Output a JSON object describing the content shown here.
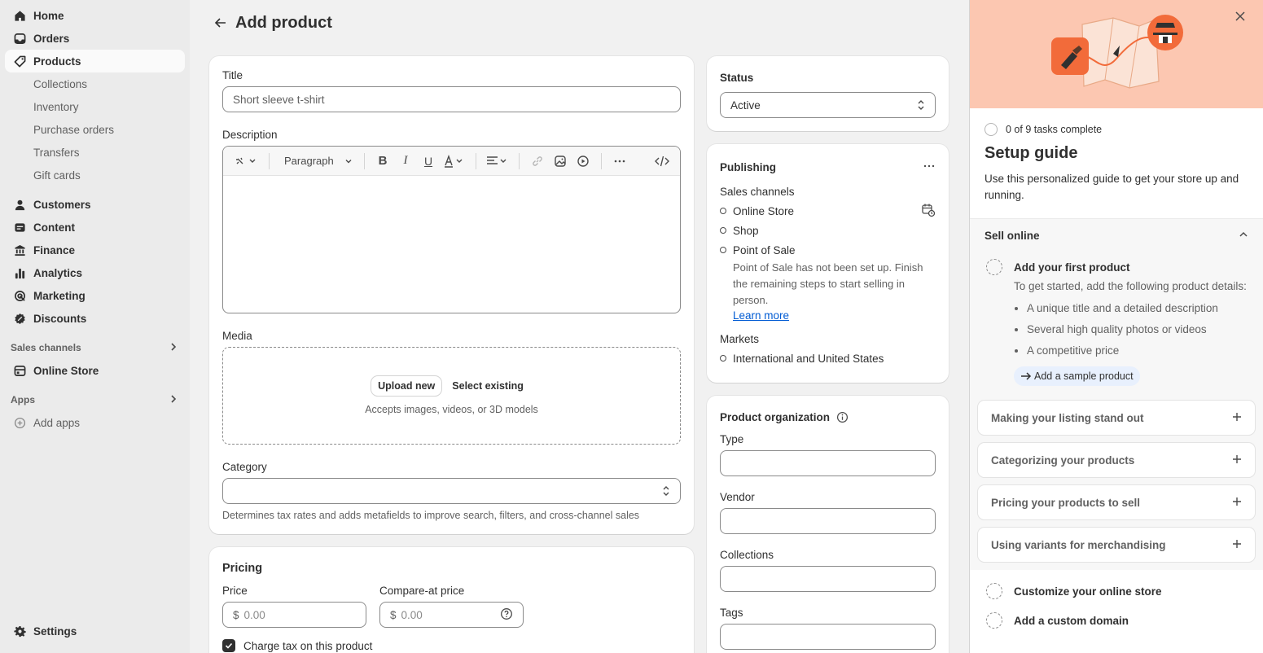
{
  "sidebar": {
    "primary": [
      {
        "label": "Home",
        "icon": "home-icon"
      },
      {
        "label": "Orders",
        "icon": "inbox-icon"
      },
      {
        "label": "Products",
        "icon": "tag-icon",
        "active": true
      }
    ],
    "product_sub": [
      "Collections",
      "Inventory",
      "Purchase orders",
      "Transfers",
      "Gift cards"
    ],
    "secondary": [
      {
        "label": "Customers",
        "icon": "person-icon"
      },
      {
        "label": "Content",
        "icon": "content-icon"
      },
      {
        "label": "Finance",
        "icon": "bank-icon"
      },
      {
        "label": "Analytics",
        "icon": "bar-chart-icon"
      },
      {
        "label": "Marketing",
        "icon": "target-icon"
      },
      {
        "label": "Discounts",
        "icon": "discount-icon"
      }
    ],
    "sales_channels_label": "Sales channels",
    "online_store_label": "Online Store",
    "apps_label": "Apps",
    "add_apps_label": "Add apps",
    "settings_label": "Settings"
  },
  "page": {
    "title": "Add product"
  },
  "product": {
    "title_label": "Title",
    "title_value": "Short sleeve t-shirt",
    "description_label": "Description",
    "paragraph_label": "Paragraph",
    "media_label": "Media",
    "upload_new": "Upload new",
    "select_existing": "Select existing",
    "media_hint": "Accepts images, videos, or 3D models",
    "category_label": "Category",
    "category_hint": "Determines tax rates and adds metafields to improve search, filters, and cross-channel sales"
  },
  "pricing": {
    "title": "Pricing",
    "price_label": "Price",
    "price_placeholder": "0.00",
    "compare_label": "Compare-at price",
    "compare_placeholder": "0.00",
    "currency": "$",
    "charge_tax": "Charge tax on this product"
  },
  "status": {
    "title": "Status",
    "value": "Active"
  },
  "publishing": {
    "title": "Publishing",
    "sales_channels": "Sales channels",
    "channels": [
      "Online Store",
      "Shop",
      "Point of Sale"
    ],
    "pos_note": "Point of Sale has not been set up. Finish the remaining steps to start selling in person.",
    "learn_more": "Learn more",
    "markets_title": "Markets",
    "markets_value": "International and United States"
  },
  "organization": {
    "title": "Product organization",
    "type_label": "Type",
    "vendor_label": "Vendor",
    "collections_label": "Collections",
    "tags_label": "Tags"
  },
  "guide": {
    "tasks_complete": "0 of 9 tasks complete",
    "title": "Setup guide",
    "description": "Use this personalized guide to get your store up and running.",
    "section": "Sell online",
    "task1_title": "Add your first product",
    "task1_desc": "To get started, add the following product details:",
    "task1_items": [
      "A unique title and a detailed description",
      "Several high quality photos or videos",
      "A competitive price"
    ],
    "sample_btn": "Add a sample product",
    "accordions": [
      "Making your listing stand out",
      "Categorizing your products",
      "Pricing your products to sell",
      "Using variants for merchandising"
    ],
    "bottom_tasks": [
      "Customize your online store",
      "Add a custom domain"
    ]
  },
  "colors": {
    "hero": "#fcc7b1",
    "accent_orange": "#f26b3a",
    "link": "#005bd3"
  }
}
